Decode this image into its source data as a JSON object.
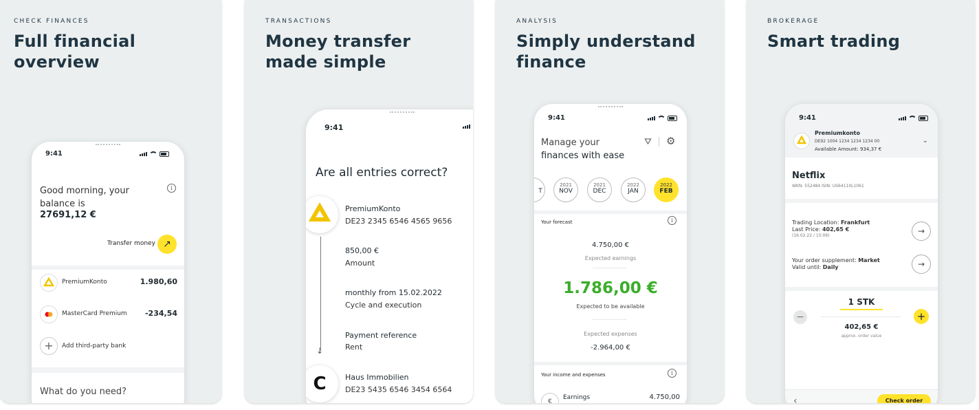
{
  "cards": [
    {
      "tag": "CHECK FINANCES",
      "title_l1": "Full financial",
      "title_l2": "overview"
    },
    {
      "tag": "TRANSACTIONS",
      "title_l1": "Money transfer",
      "title_l2": "made simple"
    },
    {
      "tag": "ANALYSIS",
      "title_l1": "Simply understand",
      "title_l2": "finance"
    },
    {
      "tag": "BROKERAGE",
      "title_l1": "Smart trading",
      "title_l2": ""
    }
  ],
  "status_time": "9:41",
  "p1": {
    "greeting_l1": "Good morning, your",
    "greeting_l2": "balance is",
    "balance": "27691,12 €",
    "transfer_label": "Transfer money",
    "accounts": [
      {
        "name": "PremiumKonto",
        "amount": "1.980,60"
      },
      {
        "name": "MasterCard Premium",
        "amount": "-234,54"
      }
    ],
    "add_bank": "Add third-party bank",
    "what_need": "What do you need?"
  },
  "p2": {
    "heading": "Are all entries correct?",
    "from_name": "PremiumKonto",
    "from_iban": "DE23 2345 6546 4565 9656",
    "amount_value": "850,00 €",
    "amount_label": "Amount",
    "cycle_value": "monthly from 15.02.2022",
    "cycle_label": "Cycle and execution",
    "ref_value": "Payment reference",
    "ref_label": "Rent",
    "to_name": "Haus Immobilien",
    "to_iban": "DE23 5435 6546 3454 6564",
    "to_avatar": "C"
  },
  "p3": {
    "heading_l1": "Manage your",
    "heading_l2": "finances with ease",
    "months": [
      {
        "year": "",
        "mon": "T",
        "active": false
      },
      {
        "year": "2021",
        "mon": "NOV",
        "active": false
      },
      {
        "year": "2021",
        "mon": "DEC",
        "active": false
      },
      {
        "year": "2022",
        "mon": "JAN",
        "active": false
      },
      {
        "year": "2022",
        "mon": "FEB",
        "active": true
      }
    ],
    "forecast_title": "Your forecast",
    "earn_value": "4.750,00 €",
    "earn_label": "Expected earnings",
    "avail_value": "1.786,00 €",
    "avail_label": "Expected to be available",
    "exp_label": "Expected expenses",
    "exp_value": "-2.964,00 €",
    "income_title": "Your income and expenses",
    "earnings_label": "Earnings",
    "earnings_value": "4.750,00"
  },
  "p4": {
    "acct_name": "Premiumkonto",
    "acct_iban": "DE92 1004 1234 1234 1234 00",
    "acct_avail": "Available Amount: 934,37 €",
    "stock_name": "Netflix",
    "wkn": "WKN: 552484  ISIN: US64110L1061",
    "loc_label": "Trading Location: ",
    "loc_value": "Frankfurt",
    "price_label": "Last Price: ",
    "price_value": "402,65 €",
    "price_date": "(16.02.22 / 15:06)",
    "supp_label": "Your order supplement: ",
    "supp_value": "Market",
    "valid_label": "Valid until: ",
    "valid_value": "Daily",
    "qty": "1 STK",
    "order_value": "402,65 €",
    "order_label": "approx. order value",
    "check_btn": "Check order",
    "back_glyph": "‹"
  },
  "colors": {
    "accent_yellow": "#ffe22b",
    "positive_green": "#3aae2a",
    "title_navy": "#1f3542"
  }
}
